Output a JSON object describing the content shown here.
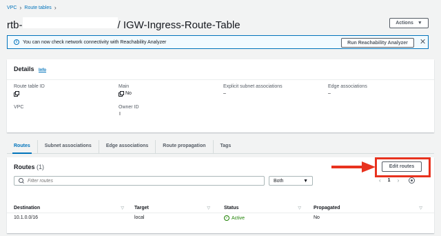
{
  "breadcrumb": {
    "items": [
      "VPC",
      "Route tables"
    ]
  },
  "page": {
    "title_prefix": "rtb-",
    "title_suffix": "/ IGW-Ingress-Route-Table"
  },
  "actions": {
    "label": "Actions"
  },
  "banner": {
    "text": "You can now check network connectivity with Reachability Analyzer",
    "button": "Run Reachability Analyzer",
    "close": "✕"
  },
  "details": {
    "title": "Details",
    "info": "Info",
    "fields": {
      "route_table_id": {
        "label": "Route table ID",
        "value": ""
      },
      "main": {
        "label": "Main",
        "value": "No"
      },
      "explicit_subnet": {
        "label": "Explicit subnet associations",
        "value": "–"
      },
      "edge_assoc": {
        "label": "Edge associations",
        "value": "–"
      },
      "vpc": {
        "label": "VPC",
        "value": ""
      },
      "owner_id": {
        "label": "Owner ID",
        "value": "I"
      }
    }
  },
  "tabs": [
    "Routes",
    "Subnet associations",
    "Edge associations",
    "Route propagation",
    "Tags"
  ],
  "routes": {
    "title": "Routes",
    "count": "(1)",
    "edit_label": "Edit routes",
    "filter_placeholder": "Filter routes",
    "select_value": "Both",
    "page": "1",
    "columns": [
      "Destination",
      "Target",
      "Status",
      "Propagated"
    ],
    "rows": [
      {
        "destination": "10.1.0.0/16",
        "target": "local",
        "status": "Active",
        "propagated": "No"
      }
    ]
  },
  "colors": {
    "accent": "#0073bb",
    "annotation": "#e8321e",
    "success": "#1d8102"
  }
}
